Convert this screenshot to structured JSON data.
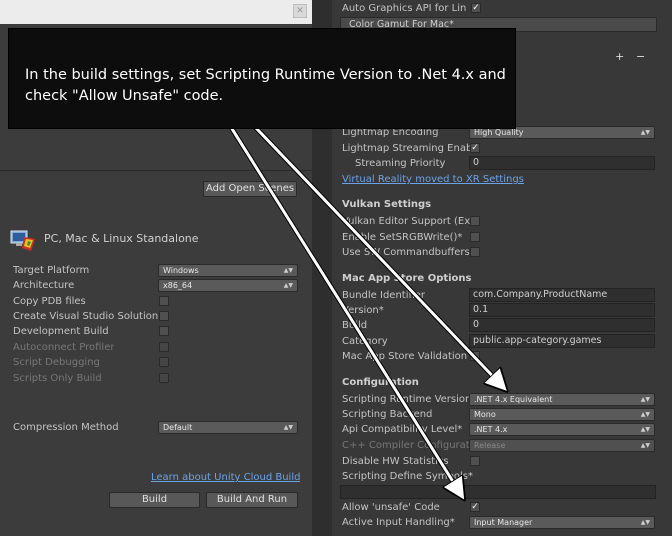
{
  "left_panel": {
    "add_open_scenes": "Add Open Scenes",
    "platform_name": "PC, Mac & Linux Standalone",
    "settings": [
      {
        "label": "Target Platform",
        "value": "Windows",
        "type": "dropdown"
      },
      {
        "label": "Architecture",
        "value": "x86_64",
        "type": "dropdown"
      },
      {
        "label": "Copy PDB files",
        "type": "checkbox"
      },
      {
        "label": "Create Visual Studio Solution",
        "type": "checkbox"
      },
      {
        "label": "Development Build",
        "type": "checkbox"
      },
      {
        "label": "Autoconnect Profiler",
        "type": "checkbox",
        "disabled": true
      },
      {
        "label": "Script Debugging",
        "type": "checkbox",
        "disabled": true
      },
      {
        "label": "Scripts Only Build",
        "type": "checkbox",
        "disabled": true
      }
    ],
    "compression": {
      "label": "Compression Method",
      "value": "Default"
    },
    "cloud_link": "Learn about Unity Cloud Build",
    "build_button": "Build",
    "build_and_run_button": "Build And Run"
  },
  "right_panel": {
    "auto_graphics": {
      "label": "Auto Graphics API  for Lin",
      "checked": true
    },
    "color_gamut_item": "Color Gamut For Mac*",
    "list_add": "+",
    "list_remove": "−",
    "lightmap_encoding": {
      "label": "Lightmap Encoding",
      "value": "High Quality"
    },
    "lightmap_streaming": {
      "label": "Lightmap Streaming Enab",
      "checked": true
    },
    "streaming_priority": {
      "label": "Streaming Priority",
      "value": "0"
    },
    "vr_link": "Virtual Reality moved to XR Settings",
    "vulkan": {
      "title": "Vulkan Settings",
      "items": [
        "Vulkan Editor Support (Ex",
        "Enable SetSRGBWrite()*",
        "Use SW Commandbuffers"
      ]
    },
    "mac_store": {
      "title": "Mac App Store Options",
      "bundle_identifier": {
        "label": "Bundle Identifier",
        "value": "com.Company.ProductName"
      },
      "version": {
        "label": "Version*",
        "value": "0.1"
      },
      "build": {
        "label": "Build",
        "value": "0"
      },
      "category": {
        "label": "Category",
        "value": "public.app-category.games"
      },
      "validation": {
        "label": "Mac App Store Validation"
      }
    },
    "configuration": {
      "title": "Configuration",
      "scripting_runtime": {
        "label": "Scripting Runtime Version",
        "value": ".NET 4.x Equivalent"
      },
      "scripting_backend": {
        "label": "Scripting Backend",
        "value": "Mono"
      },
      "api_compat": {
        "label": "Api Compatibility Level*",
        "value": ".NET 4.x"
      },
      "cpp_compiler": {
        "label": "C++ Compiler Configurati",
        "value": "Release"
      },
      "disable_hw_stats": {
        "label": "Disable HW Statistics"
      },
      "define_symbols": {
        "label": "Scripting Define Symbols*",
        "value": ""
      },
      "allow_unsafe": {
        "label": "Allow 'unsafe' Code",
        "checked": true
      },
      "active_input": {
        "label": "Active Input Handling*",
        "value": "Input Manager"
      }
    }
  },
  "callout": {
    "text": "In the build settings, set Scripting Runtime Version to .Net 4.x and check \"Allow Unsafe\" code."
  },
  "colors": {
    "callout_bg": "#0d0d0d",
    "link": "#6aa3e8",
    "arrow": "#ffffff"
  }
}
